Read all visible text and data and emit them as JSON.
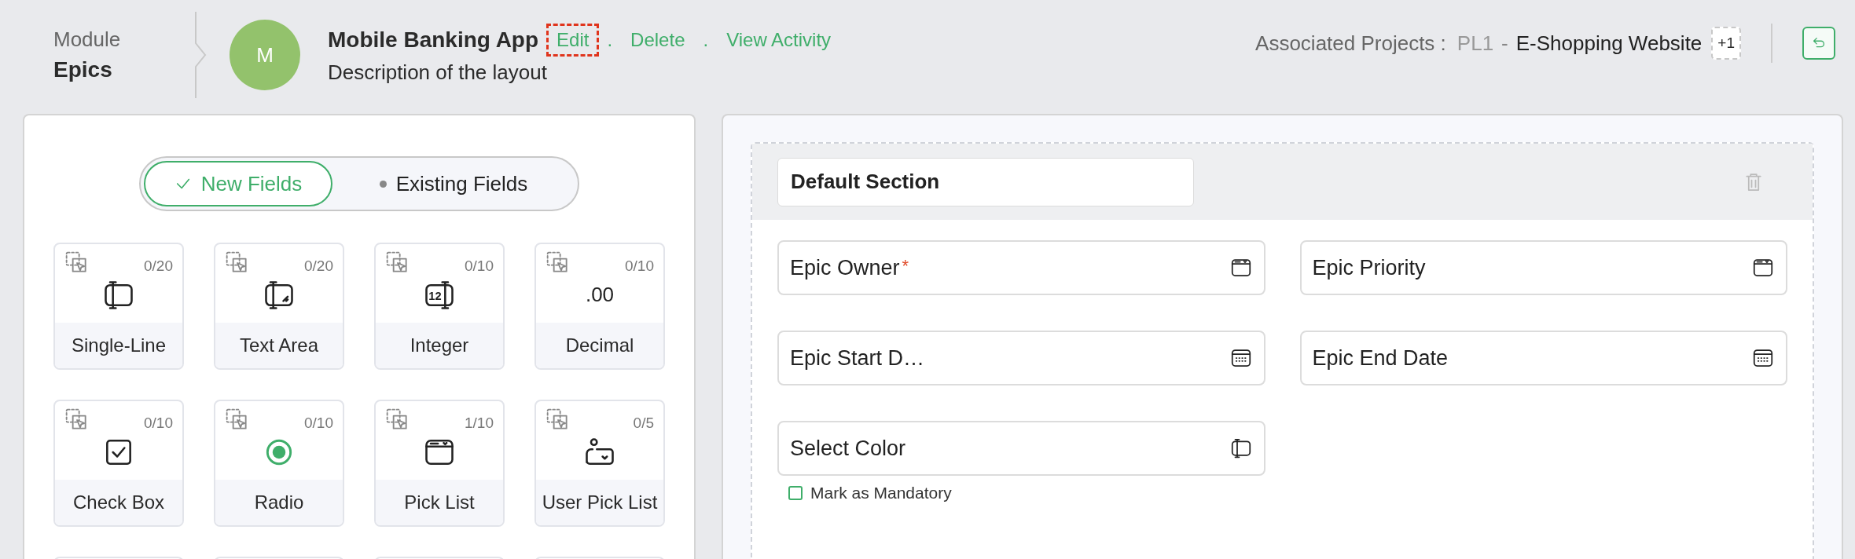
{
  "breadcrumb": {
    "module": "Module",
    "current": "Epics"
  },
  "header": {
    "avatar": "M",
    "title": "Mobile Banking App",
    "description": "Description of the layout",
    "actions": [
      {
        "kind": "link",
        "label": "Edit",
        "focused": true
      },
      {
        "kind": "separator",
        "label": "."
      },
      {
        "kind": "link",
        "label": "Delete",
        "focused": false
      },
      {
        "kind": "separator",
        "label": "."
      },
      {
        "kind": "link",
        "label": "View Activity",
        "focused": false
      }
    ],
    "associated_label": "Associated Projects :",
    "project_code": "PL1",
    "project_separator": "-",
    "project_name": "E-Shopping Website",
    "more_count": "+1"
  },
  "field_tabs": [
    {
      "label": "New Fields",
      "selected": true
    },
    {
      "label": "Existing Fields",
      "selected": false
    }
  ],
  "field_types": [
    {
      "kind": "single_line",
      "label": "Single-Line",
      "count": "0/20"
    },
    {
      "kind": "text_area",
      "label": "Text Area",
      "count": "0/20"
    },
    {
      "kind": "integer",
      "label": "Integer",
      "count": "0/10",
      "icon_text": "12"
    },
    {
      "kind": "decimal",
      "label": "Decimal",
      "count": "0/10",
      "icon_text": ".00"
    },
    {
      "kind": "checkbox",
      "label": "Check Box",
      "count": "0/10"
    },
    {
      "kind": "radio",
      "label": "Radio",
      "count": "0/10"
    },
    {
      "kind": "picklist",
      "label": "Pick List",
      "count": "1/10"
    },
    {
      "kind": "user_picklist",
      "label": "User Pick List",
      "count": "0/5"
    },
    {
      "kind": "partial"
    },
    {
      "kind": "partial"
    },
    {
      "kind": "partial"
    },
    {
      "kind": "partial"
    }
  ],
  "section": {
    "name": "Default Section",
    "required_mark": "*",
    "fields": [
      {
        "kind": "picklist",
        "label": "Epic Owner",
        "required": true
      },
      {
        "kind": "picklist",
        "label": "Epic Priority",
        "required": false
      },
      {
        "kind": "date",
        "label": "Epic Start D…",
        "required": false
      },
      {
        "kind": "date",
        "label": "Epic End Date",
        "required": false
      },
      {
        "kind": "single_line",
        "label": "Select Color",
        "required": false,
        "mandatory_option": {
          "label": "Mark as Mandatory",
          "checked": false
        }
      }
    ]
  }
}
